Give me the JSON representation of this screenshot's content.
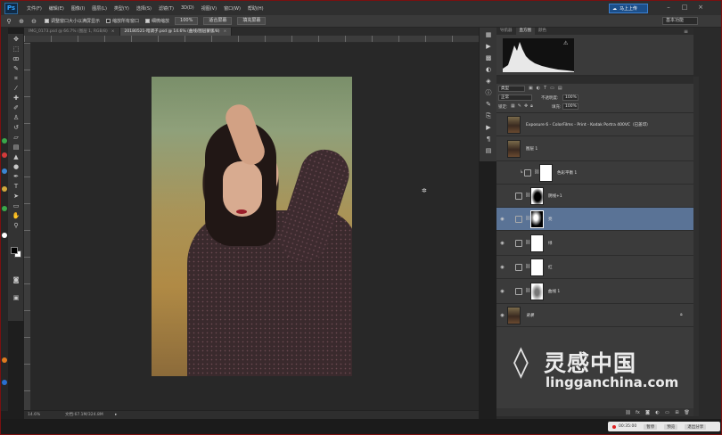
{
  "app": {
    "logo": "Ps",
    "cloud_button": "马上上传"
  },
  "menu": [
    "文件(F)",
    "编辑(E)",
    "图像(I)",
    "图层(L)",
    "类型(Y)",
    "选择(S)",
    "滤镜(T)",
    "3D(D)",
    "视图(V)",
    "窗口(W)",
    "帮助(H)"
  ],
  "options": {
    "check1": "调整窗口大小以满屏显示",
    "check2": "缩放所有窗口",
    "check3": "细微缩放",
    "zoom_value": "100%",
    "btn_fit": "适合屏幕",
    "btn_fill": "填充屏幕",
    "workspace": "基本功能"
  },
  "doc_tabs": [
    {
      "label": "IMG_0173.psd @ 66.7% (图层 1, RGB/8)",
      "active": false
    },
    {
      "label": "20180521-暗调子.psd @ 14.6% (曲线/图层蒙版/8)",
      "active": true
    }
  ],
  "status": {
    "zoom": "14.6%",
    "doc_info": "文档:67.1M/324.8M"
  },
  "histogram": {
    "tabs": [
      "导航器",
      "直方图",
      "颜色"
    ],
    "active_tab": 1
  },
  "layers": {
    "kind_select": "类型",
    "blend_mode": "正常",
    "opacity_label": "不透明度:",
    "opacity_value": "100%",
    "lock_label": "锁定:",
    "fill_label": "填充:",
    "fill_value": "100%",
    "rows": [
      {
        "name": "Exposure 6 - ColorFilms - Print - Kodak Portra 400VC（已盖印）",
        "thumb": "photo",
        "selected": false
      },
      {
        "name": "图层 1",
        "thumb": "photo",
        "selected": false
      },
      {
        "name": "色彩平衡 1",
        "thumb": "mask-white",
        "selected": false
      },
      {
        "name": "阴线+1",
        "thumb": "mask-bw1",
        "selected": false
      },
      {
        "name": "亮",
        "thumb": "mask-bw2",
        "selected": true
      },
      {
        "name": "绿",
        "thumb": "mask-white",
        "selected": false
      },
      {
        "name": "红",
        "thumb": "mask-white",
        "selected": false
      },
      {
        "name": "曲线 1",
        "thumb": "mask-bw3",
        "selected": false
      },
      {
        "name": "背景",
        "thumb": "photo",
        "selected": false
      }
    ]
  },
  "taskbar": {
    "time": "00:35:00",
    "btn1": "暂停",
    "btn2": "预览",
    "btn3": "退出分享"
  },
  "watermark": {
    "cn": "灵感中国",
    "en": "lingganchina.com"
  }
}
